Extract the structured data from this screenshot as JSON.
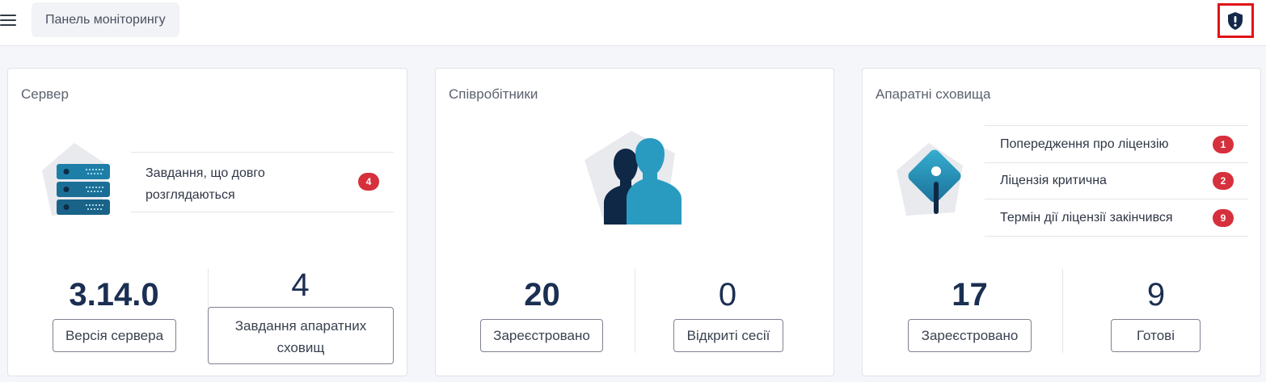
{
  "header": {
    "breadcrumb": "Панель моніторингу",
    "menu_icon": "hamburger-menu-icon",
    "alert_icon": "shield-exclamation-icon",
    "alert_border_color": "#e01418"
  },
  "cards": {
    "server": {
      "title": "Сервер",
      "icon": "server-rack-icon",
      "task_label": "Завдання, що довго розглядаються",
      "task_count": "4",
      "version_value": "3.14.0",
      "version_label": "Версія сервера",
      "storage_tasks_value": "4",
      "storage_tasks_label": "Завдання апаратних сховищ"
    },
    "employees": {
      "title": "Співробітники",
      "icon": "users-icon",
      "registered_value": "20",
      "registered_label": "Зареєстровано",
      "sessions_value": "0",
      "sessions_label": "Відкриті сесії"
    },
    "storage": {
      "title": "Апаратні сховища",
      "icon": "warning-info-icon",
      "alerts": [
        {
          "label": "Попередження про ліцензію",
          "count": "1"
        },
        {
          "label": "Ліцензія критична",
          "count": "2"
        },
        {
          "label": "Термін дії ліцензії закінчився",
          "count": "9"
        }
      ],
      "registered_value": "17",
      "registered_label": "Зареєстровано",
      "ready_value": "9",
      "ready_label": "Готові"
    }
  },
  "colors": {
    "badge": "#d6303c",
    "number_text": "#1b2f52",
    "icon_dark": "#0f2845",
    "icon_light": "#2a9bc0"
  }
}
